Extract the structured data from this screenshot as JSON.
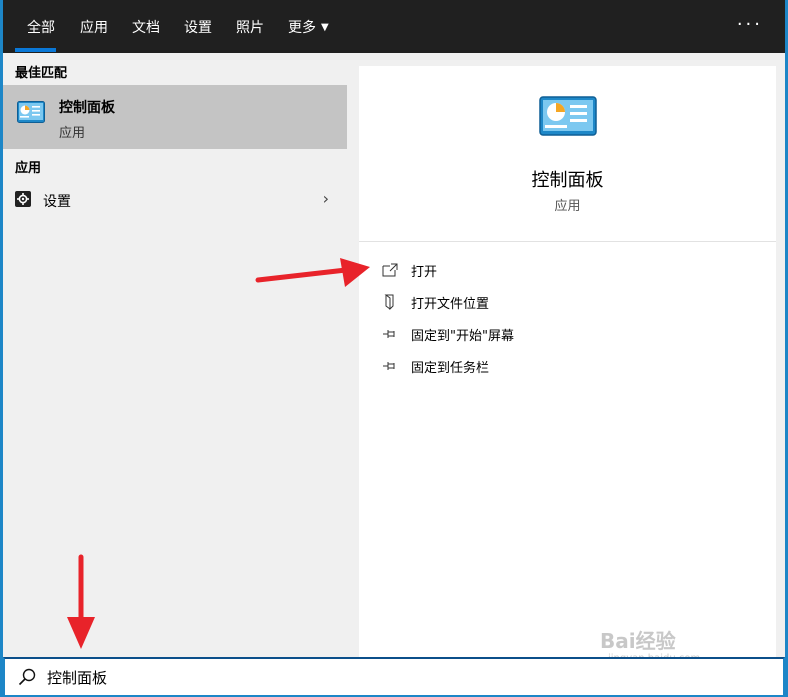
{
  "tabs": [
    {
      "label": "全部",
      "active": true
    },
    {
      "label": "应用",
      "active": false
    },
    {
      "label": "文档",
      "active": false
    },
    {
      "label": "设置",
      "active": false
    },
    {
      "label": "照片",
      "active": false
    },
    {
      "label": "更多",
      "active": false
    }
  ],
  "more_menu_icon": "ellipsis-icon",
  "left": {
    "best_match_heading": "最佳匹配",
    "best_match": {
      "title": "控制面板",
      "subtitle": "应用",
      "icon": "control-panel-icon"
    },
    "apps_heading": "应用",
    "apps": [
      {
        "label": "设置",
        "icon": "gear-icon"
      }
    ]
  },
  "detail": {
    "title": "控制面板",
    "subtitle": "应用",
    "actions": [
      {
        "label": "打开",
        "icon": "open-icon"
      },
      {
        "label": "打开文件位置",
        "icon": "file-location-icon"
      },
      {
        "label": "固定到\"开始\"屏幕",
        "icon": "pin-icon"
      },
      {
        "label": "固定到任务栏",
        "icon": "pin-icon"
      }
    ]
  },
  "search": {
    "value": "控制面板",
    "icon": "search-icon"
  },
  "watermark": {
    "text": "Bai经验",
    "url": "jingyan.baidu.com"
  },
  "colors": {
    "accent": "#0a78d7",
    "titlebar": "#202020",
    "highlight": "#c4c4c4",
    "arrow": "#e8232a"
  }
}
